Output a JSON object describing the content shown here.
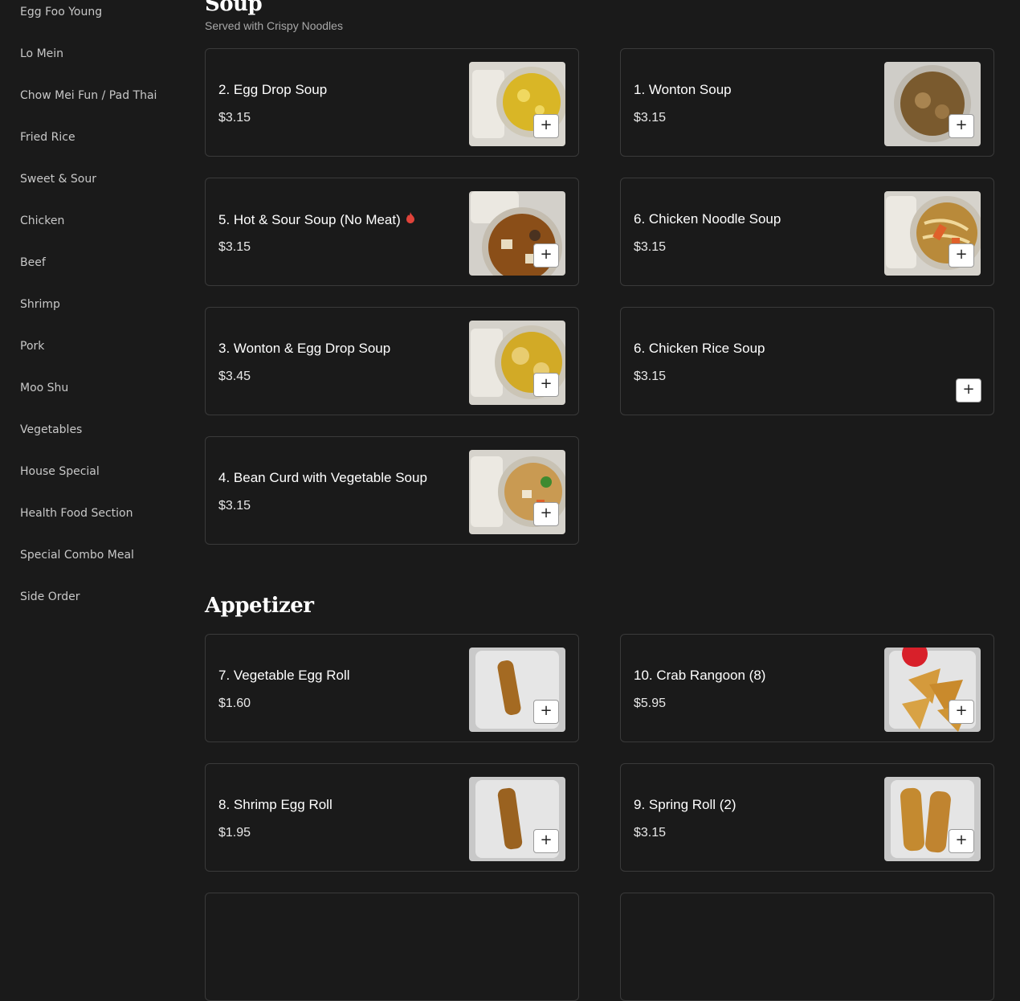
{
  "sidebar": {
    "items": [
      "Egg Foo Young",
      "Lo Mein",
      "Chow Mei Fun / Pad Thai",
      "Fried Rice",
      "Sweet & Sour",
      "Chicken",
      "Beef",
      "Shrimp",
      "Pork",
      "Moo Shu",
      "Vegetables",
      "House Special",
      "Health Food Section",
      "Special Combo Meal",
      "Side Order"
    ]
  },
  "sections": {
    "soup": {
      "title": "Soup",
      "subtitle": "Served with Crispy Noodles",
      "items": [
        {
          "name": "2. Egg Drop Soup",
          "price": "$3.15",
          "image": "egg-drop-soup-photo"
        },
        {
          "name": "1. Wonton Soup",
          "price": "$3.15",
          "image": "wonton-soup-photo"
        },
        {
          "name": "5. Hot & Sour Soup (No Meat)",
          "price": "$3.15",
          "image": "hot-sour-soup-photo",
          "spicy": true
        },
        {
          "name": "6. Chicken Noodle Soup",
          "price": "$3.15",
          "image": "chicken-noodle-soup-photo"
        },
        {
          "name": "3. Wonton & Egg Drop Soup",
          "price": "$3.45",
          "image": "wonton-egg-drop-soup-photo"
        },
        {
          "name": "6. Chicken Rice Soup",
          "price": "$3.15"
        },
        {
          "name": "4. Bean Curd with Vegetable Soup",
          "price": "$3.15",
          "image": "bean-curd-soup-photo"
        }
      ]
    },
    "appetizer": {
      "title": "Appetizer",
      "items": [
        {
          "name": "7. Vegetable Egg Roll",
          "price": "$1.60",
          "image": "vegetable-egg-roll-photo"
        },
        {
          "name": "10. Crab Rangoon (8)",
          "price": "$5.95",
          "image": "crab-rangoon-photo"
        },
        {
          "name": "8. Shrimp Egg Roll",
          "price": "$1.95",
          "image": "shrimp-egg-roll-photo"
        },
        {
          "name": "9. Spring Roll (2)",
          "price": "$3.15",
          "image": "spring-roll-photo"
        }
      ]
    }
  },
  "add_button": {
    "label": "+",
    "icon": "plus-icon"
  },
  "colors": {
    "background": "#1a1a1a",
    "card_border": "#3a3a3a",
    "spicy": "#e0433a"
  }
}
